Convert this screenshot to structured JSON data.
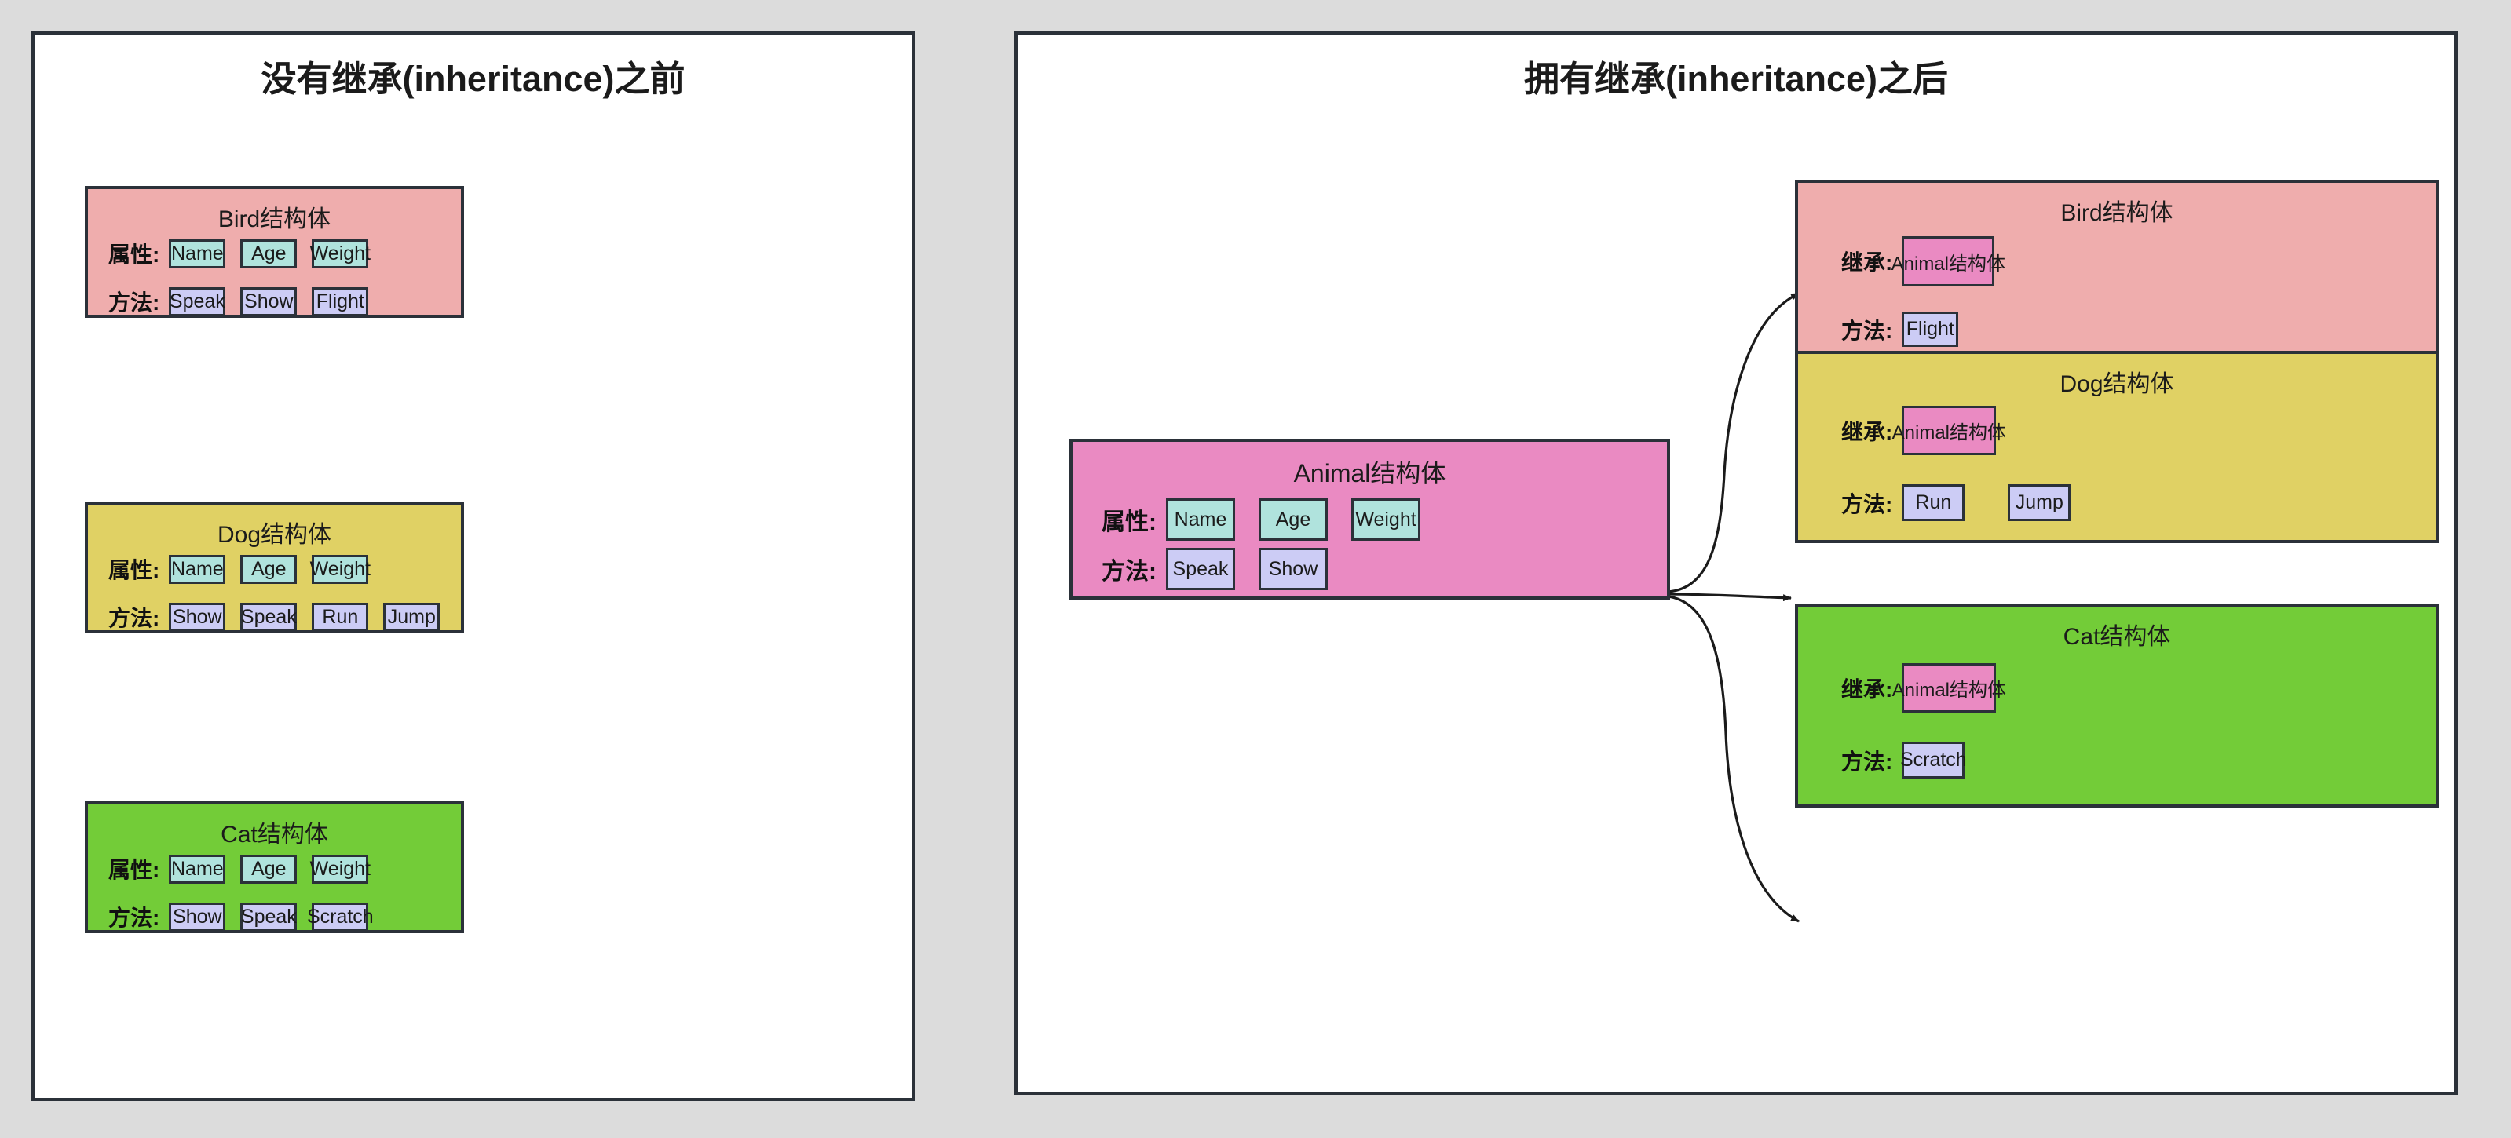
{
  "left_panel": {
    "title": "没有继承(inheritance)之前",
    "structs": [
      {
        "title": "Bird结构体",
        "color": "#efadad",
        "attr_label": "属性:",
        "method_label": "方法:",
        "attributes": [
          "Name",
          "Age",
          "Weight"
        ],
        "methods": [
          "Speak",
          "Show",
          "Flight"
        ]
      },
      {
        "title": "Dog结构体",
        "color": "#e0d164",
        "attr_label": "属性:",
        "method_label": "方法:",
        "attributes": [
          "Name",
          "Age",
          "Weight"
        ],
        "methods": [
          "Show",
          "Speak",
          "Run",
          "Jump"
        ]
      },
      {
        "title": "Cat结构体",
        "color": "#73cc38",
        "attr_label": "属性:",
        "method_label": "方法:",
        "attributes": [
          "Name",
          "Age",
          "Weight"
        ],
        "methods": [
          "Show",
          "Speak",
          "Scratch"
        ]
      }
    ]
  },
  "right_panel": {
    "title": "拥有继承(inheritance)之后",
    "base_struct": {
      "title": "Animal结构体",
      "color": "#ea8ac2",
      "attr_label": "属性:",
      "method_label": "方法:",
      "attributes": [
        "Name",
        "Age",
        "Weight"
      ],
      "methods": [
        "Speak",
        "Show"
      ]
    },
    "derived_structs": [
      {
        "title": "Bird结构体",
        "color": "#efadad",
        "inherit_label": "继承:",
        "method_label": "方法:",
        "inherits": "Animal结构体",
        "methods": [
          "Flight"
        ]
      },
      {
        "title": "Dog结构体",
        "color": "#e0d164",
        "inherit_label": "继承:",
        "method_label": "方法:",
        "inherits": "Animal结构体",
        "methods": [
          "Run",
          "Jump"
        ]
      },
      {
        "title": "Cat结构体",
        "color": "#73cc38",
        "inherit_label": "继承:",
        "method_label": "方法:",
        "inherits": "Animal结构体",
        "methods": [
          "Scratch"
        ]
      }
    ]
  },
  "palette": {
    "background": "#dcdcdc",
    "panel_bg": "#ffffff",
    "stroke": "#2b3139",
    "attr_chip": "#b0e3dd",
    "method_chip": "#ccccf5",
    "bird": "#efadad",
    "dog": "#e0d164",
    "cat": "#73cc38",
    "animal": "#ea8ac2"
  }
}
